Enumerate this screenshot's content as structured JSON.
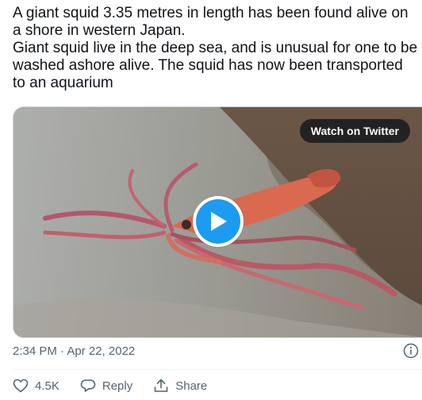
{
  "tweet": {
    "text": "A giant squid 3.35 metres in length has been found alive on a shore in western Japan.\nGiant squid live in the deep sea, and is unusual for one to be washed ashore alive. The squid has now been transported to an aquarium",
    "timestamp": "2:34 PM · Apr 22, 2022"
  },
  "media": {
    "watch_label": "Watch on Twitter",
    "play_icon": "play-icon"
  },
  "actions": {
    "like_icon": "heart-icon",
    "like_count": "4.5K",
    "reply_icon": "reply-bubble-icon",
    "reply_label": "Reply",
    "share_icon": "share-icon",
    "share_label": "Share"
  },
  "info_icon": "info-icon",
  "colors": {
    "accent": "#1d9bf0",
    "text": "#0f1419",
    "muted": "#536471"
  }
}
